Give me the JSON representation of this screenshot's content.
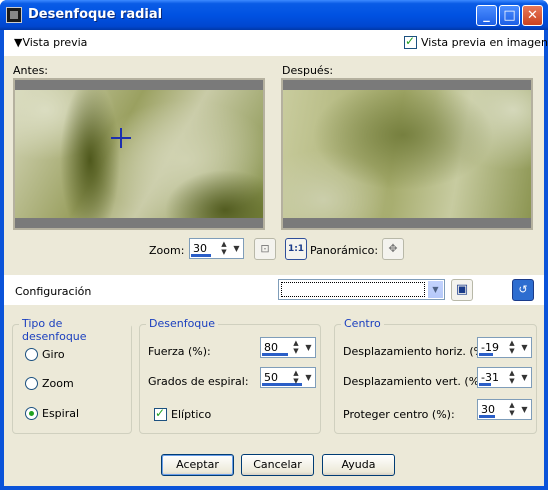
{
  "window": {
    "title": "Desenfoque radial",
    "controls": [
      "minimize-icon",
      "maximize-icon",
      "close-icon"
    ]
  },
  "preview_bar": {
    "toggle_label": "Vista previa",
    "image_preview_label": "Vista previa en imagen",
    "image_preview_checked": true
  },
  "preview": {
    "before_label": "Antes:",
    "after_label": "Después:",
    "zoom_label": "Zoom:",
    "zoom_value": "30",
    "fit_icon": "zoom-fit-icon",
    "actual_size_label": "1:1",
    "pan_label": "Panorámico:",
    "pan_icon": "move-icon"
  },
  "config": {
    "label": "Configuración",
    "preset_value": "",
    "save_icon": "save-preset-icon",
    "reset_icon": "reset-icon"
  },
  "blur_type": {
    "title": "Tipo de desenfoque",
    "options": [
      "Giro",
      "Zoom",
      "Espiral"
    ],
    "selected": "Espiral"
  },
  "blur": {
    "title": "Desenfoque",
    "strength_label": "Fuerza (%):",
    "strength_value": "80",
    "spiral_label": "Grados de espiral:",
    "spiral_value": "50",
    "elliptic_label": "Elíptico",
    "elliptic_checked": true
  },
  "center": {
    "title": "Centro",
    "h_offset_label": "Desplazamiento horiz. (%):",
    "h_offset_value": "-19",
    "v_offset_label": "Desplazamiento vert. (%):",
    "v_offset_value": "-31",
    "protect_label": "Proteger centro (%):",
    "protect_value": "30"
  },
  "buttons": {
    "ok": "Aceptar",
    "cancel": "Cancelar",
    "help": "Ayuda"
  }
}
